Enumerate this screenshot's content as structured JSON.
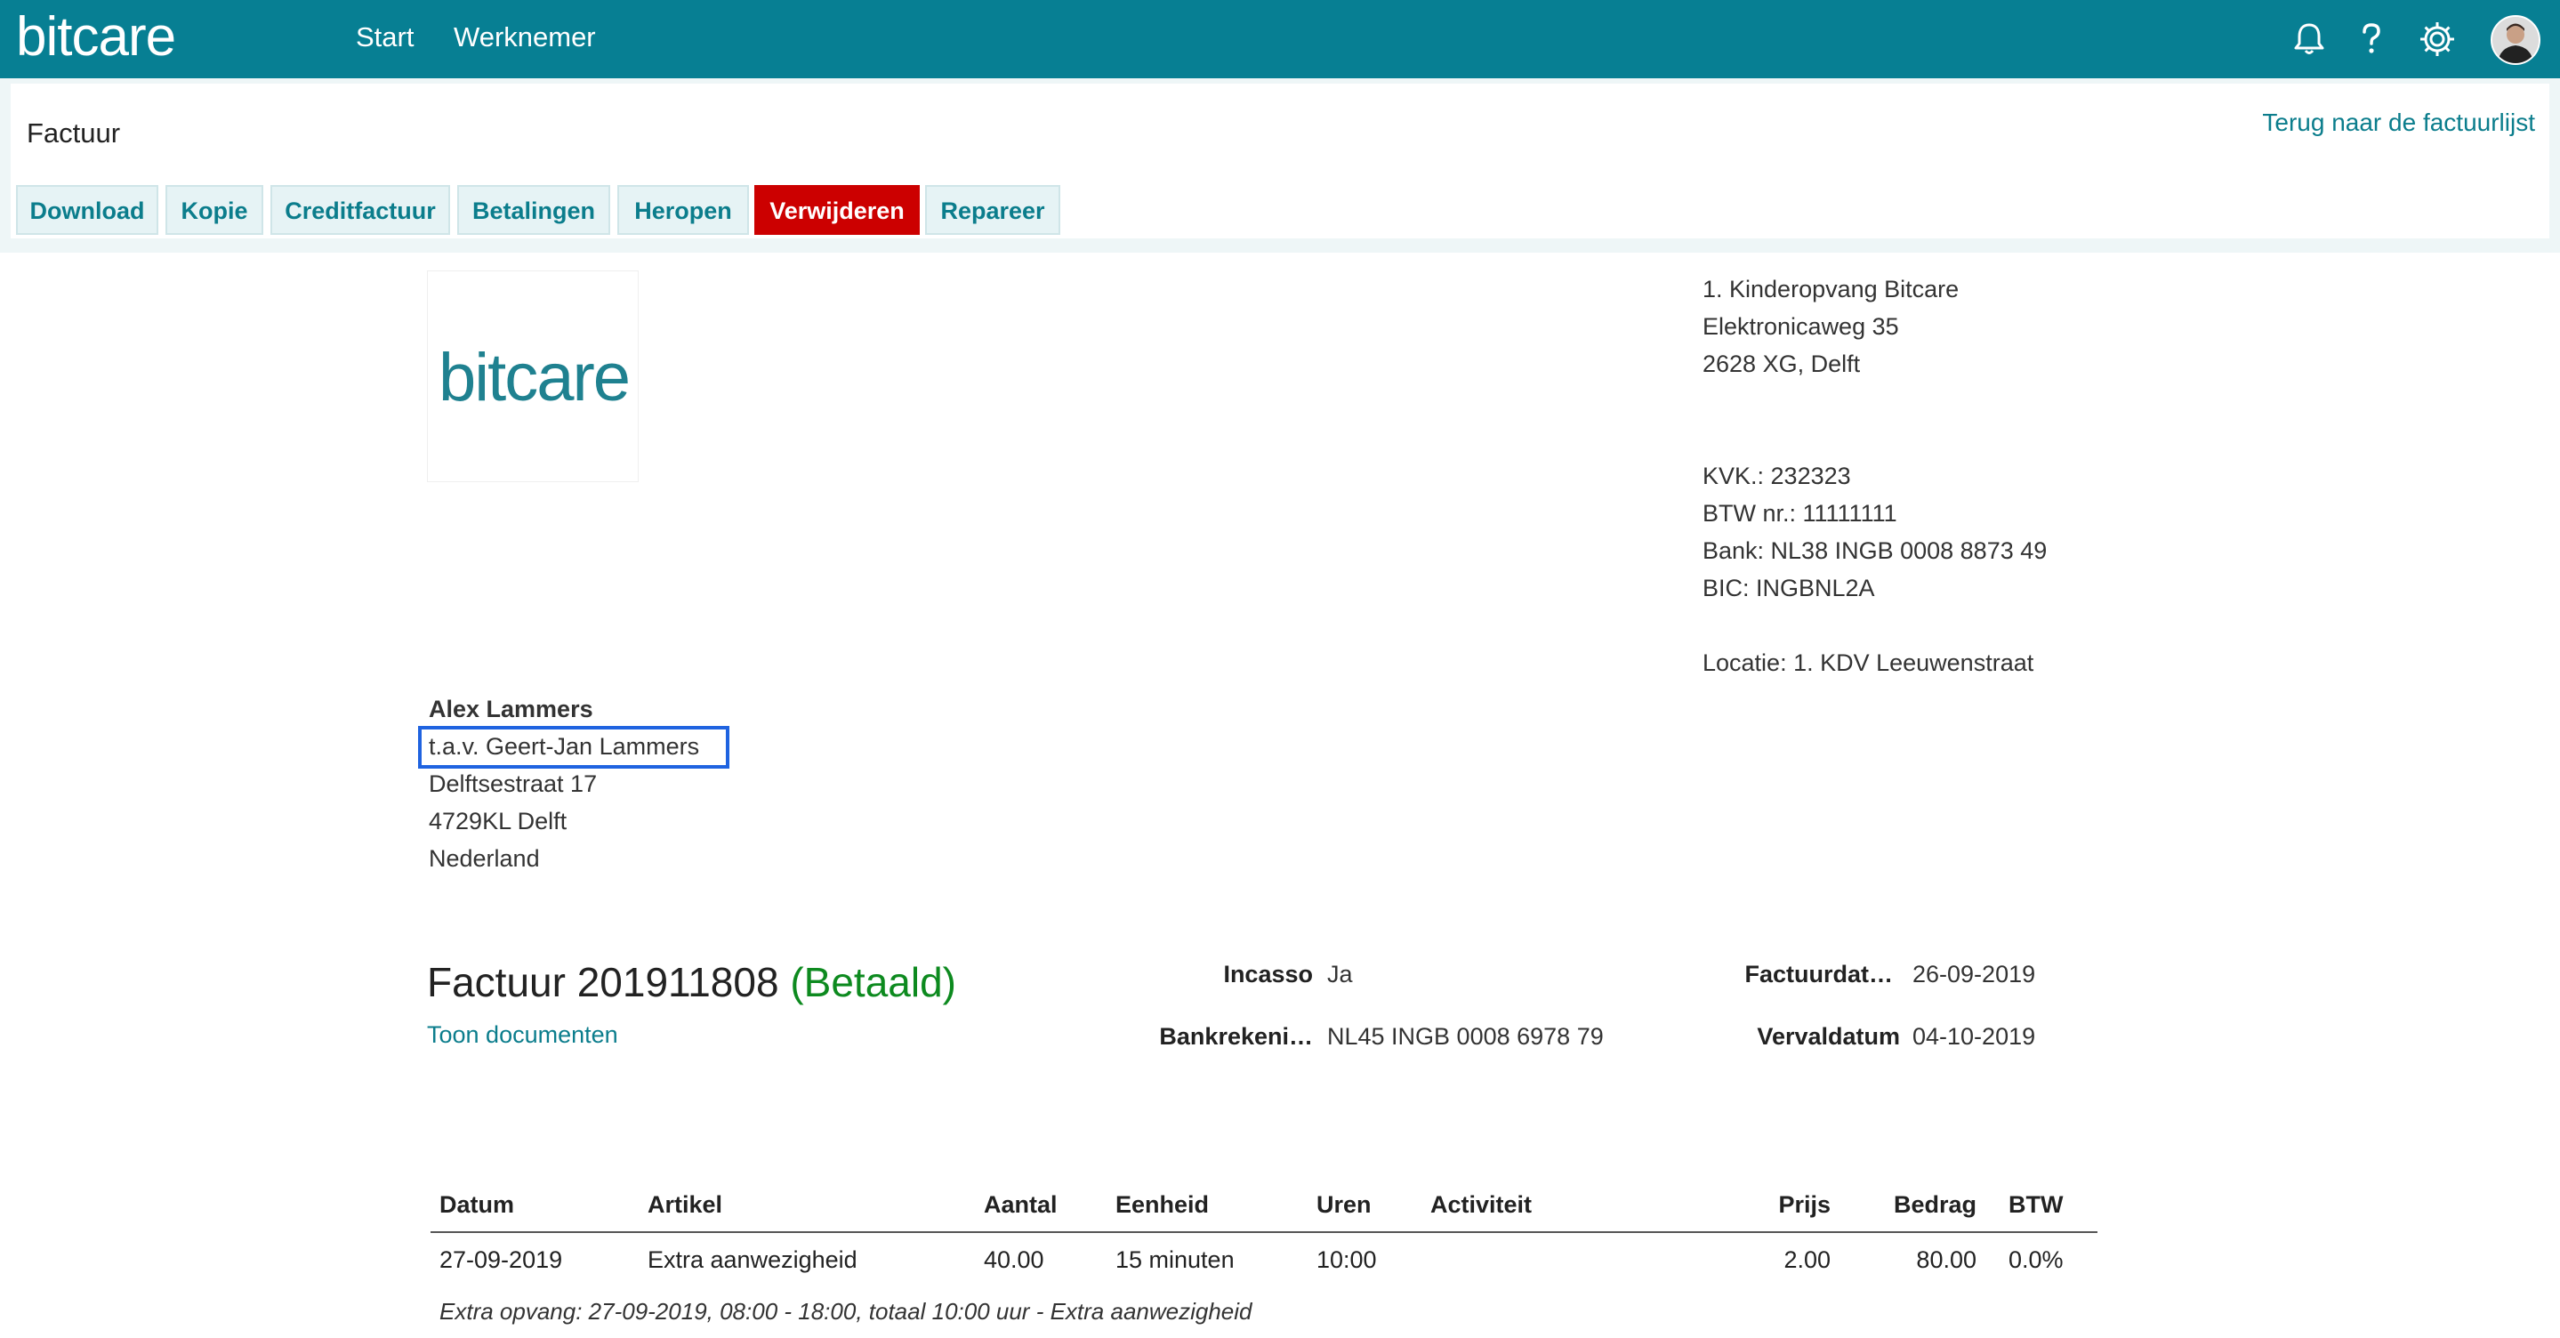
{
  "app": {
    "logo": "bitcare",
    "nav": [
      "Start",
      "Werknemer"
    ],
    "icons": [
      "bell-icon",
      "help-icon",
      "gear-icon",
      "avatar"
    ]
  },
  "page": {
    "title": "Factuur",
    "back_link": "Terug naar de factuurlijst"
  },
  "toolbar": [
    {
      "label": "Download"
    },
    {
      "label": "Kopie"
    },
    {
      "label": "Creditfactuur"
    },
    {
      "label": "Betalingen"
    },
    {
      "label": "Heropen"
    },
    {
      "label": "Verwijderen",
      "danger": true
    },
    {
      "label": "Repareer"
    }
  ],
  "company": {
    "logo_text": "bitcare",
    "name": "1. Kinderopvang Bitcare",
    "street": "Elektronicaweg 35",
    "city": "2628 XG, Delft",
    "kvk": "KVK.: 232323",
    "btw": "BTW nr.: 11111111",
    "bank": "Bank: NL38 INGB 0008 8873 49",
    "bic": "BIC: INGBNL2A",
    "location": "Locatie: 1. KDV Leeuwenstraat"
  },
  "recipient": {
    "name": "Alex Lammers",
    "attention": "t.a.v. Geert-Jan Lammers",
    "street": "Delftsestraat 17",
    "city": "4729KL Delft",
    "country": "Nederland"
  },
  "invoice": {
    "title": "Factuur 201911808",
    "status": "(Betaald)",
    "docs_link": "Toon documenten",
    "incasso_label": "Incasso",
    "incasso_value": "Ja",
    "bank_label": "Bankrekeni…",
    "bank_value": "NL45 INGB 0008 6978 79",
    "date_label": "Factuurdat…",
    "date_value": "26-09-2019",
    "due_label": "Vervaldatum",
    "due_value": "04-10-2019"
  },
  "lines": {
    "headers": [
      "Datum",
      "Artikel",
      "Aantal",
      "Eenheid",
      "Uren",
      "Activiteit",
      "Prijs",
      "Bedrag",
      "BTW"
    ],
    "rows": [
      [
        "27-09-2019",
        "Extra aanwezigheid",
        "40.00",
        "15 minuten",
        "10:00",
        "",
        "2.00",
        "80.00",
        "0.0%"
      ]
    ],
    "note": "Extra opvang: 27-09-2019, 08:00 - 18:00, totaal 10:00 uur - Extra aanwezigheid"
  },
  "colors": {
    "brand": "#077f93",
    "link": "#0b7d8c",
    "danger": "#cc0000",
    "paid": "#0d8a1f",
    "highlight": "#1f63e0"
  }
}
